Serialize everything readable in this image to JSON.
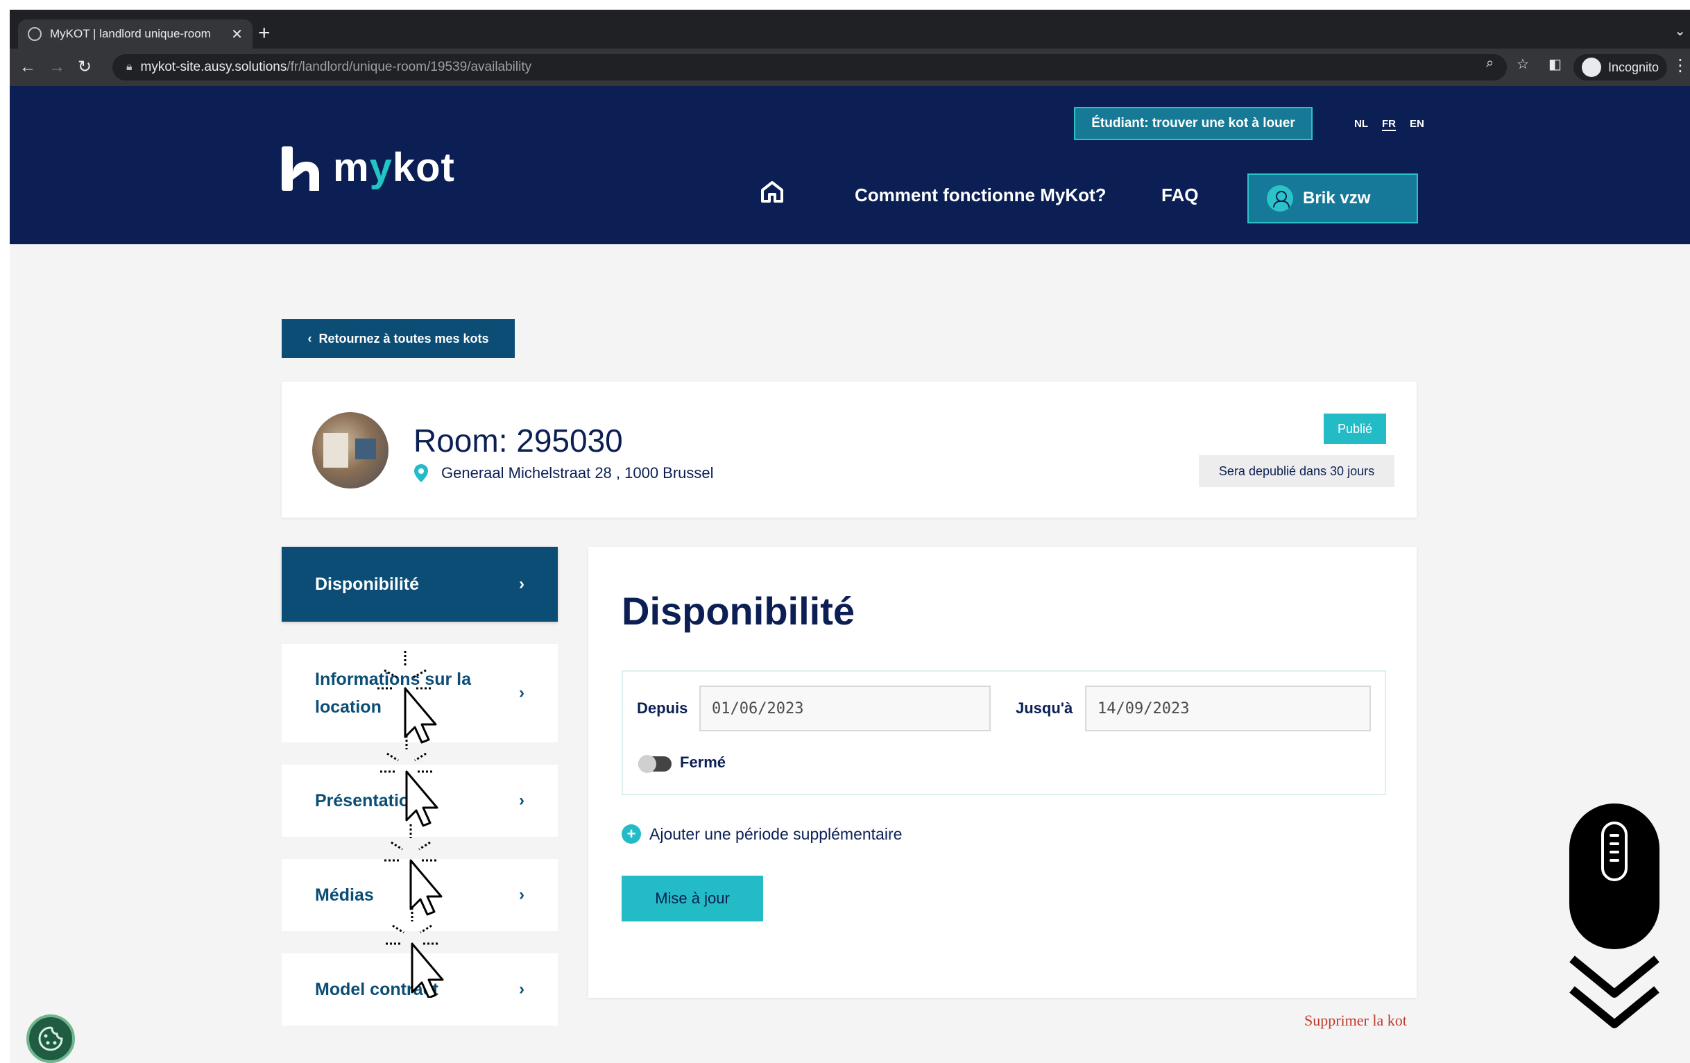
{
  "browser": {
    "tab_title": "MyKOT | landlord unique-room",
    "url_host": "mykot-site.ausy.solutions",
    "url_path": "/fr/landlord/unique-room/19539/availability",
    "incognito_label": "Incognito"
  },
  "header": {
    "logo_prefix": "m",
    "logo_y": "y",
    "logo_suffix": "kot",
    "student_button": "Étudiant: trouver une kot à louer",
    "languages": [
      "NL",
      "FR",
      "EN"
    ],
    "active_language": "FR",
    "nav": {
      "how_it_works": "Comment fonctionne MyKot?",
      "faq": "FAQ"
    },
    "user_name": "Brik vzw"
  },
  "back_button": "Retournez à toutes mes kots",
  "room": {
    "title": "Room: 295030",
    "address": "Generaal Michelstraat 28 , 1000 Brussel",
    "status": "Publié",
    "unpublish_note": "Sera depublié dans 30 jours"
  },
  "sidebar": {
    "items": [
      {
        "label": "Disponibilité",
        "active": true
      },
      {
        "label": "Informations sur la location",
        "active": false
      },
      {
        "label": "Présentation",
        "active": false
      },
      {
        "label": "Médias",
        "active": false
      },
      {
        "label": "Model contract",
        "active": false
      }
    ]
  },
  "availability": {
    "title": "Disponibilité",
    "from_label": "Depuis",
    "from_value": "01/06/2023",
    "to_label": "Jusqu'à",
    "to_value": "14/09/2023",
    "closed_label": "Fermé",
    "closed": false,
    "add_period": "Ajouter une période supplémentaire",
    "update_button": "Mise à jour"
  },
  "delete_link": "Supprimer la kot",
  "colors": {
    "navy": "#0b1f55",
    "teal": "#23bcc6",
    "petrol": "#0b4d75",
    "danger": "#c0392b"
  }
}
